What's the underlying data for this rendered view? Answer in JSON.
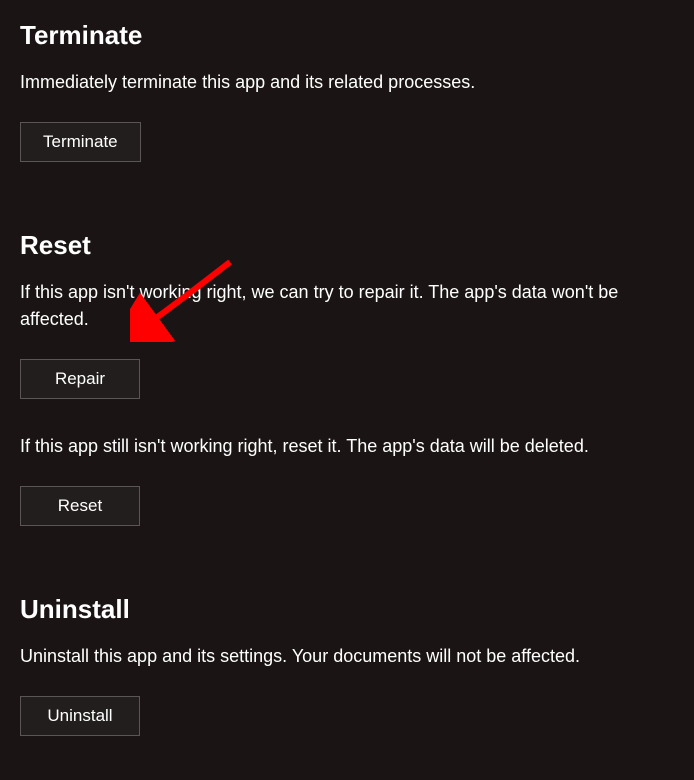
{
  "terminate": {
    "heading": "Terminate",
    "description": "Immediately terminate this app and its related processes.",
    "button_label": "Terminate"
  },
  "reset": {
    "heading": "Reset",
    "repair_description": "If this app isn't working right, we can try to repair it. The app's data won't be affected.",
    "repair_button_label": "Repair",
    "reset_description": "If this app still isn't working right, reset it. The app's data will be deleted.",
    "reset_button_label": "Reset"
  },
  "uninstall": {
    "heading": "Uninstall",
    "description": "Uninstall this app and its settings. Your documents will not be affected.",
    "button_label": "Uninstall"
  },
  "annotation": {
    "arrow_color": "#ff0000"
  }
}
